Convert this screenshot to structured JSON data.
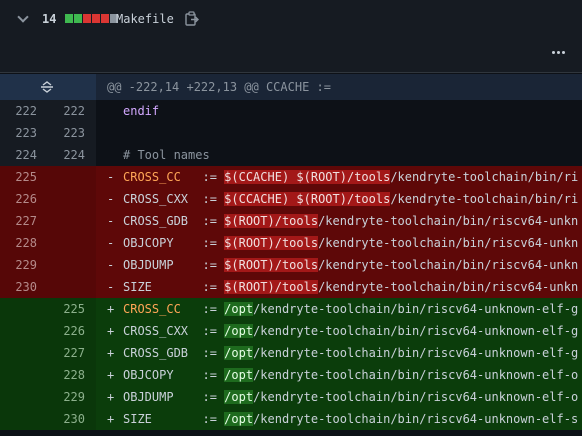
{
  "file": {
    "change_count": "14",
    "name": "Makefile",
    "diffstat": [
      "#3fb950",
      "#3fb950",
      "#da3633",
      "#da3633",
      "#da3633",
      "#8b949e"
    ]
  },
  "hunk": {
    "header": "@@ -222,14 +222,13 @@ CCACHE :="
  },
  "context_lines": [
    {
      "old": "222",
      "new": "222",
      "text": "endif"
    },
    {
      "old": "223",
      "new": "223",
      "text": ""
    },
    {
      "old": "224",
      "new": "224",
      "text": "# Tool names"
    }
  ],
  "deleted_lines": [
    {
      "old": "225",
      "name": "CROSS_CC ",
      "assign": "  := ",
      "hl": "$(CCACHE) $(ROOT)/tools",
      "rest": "/kendryte-toolchain/bin/ri"
    },
    {
      "old": "226",
      "name": "CROSS_CXX",
      "assign": "  := ",
      "hl": "$(CCACHE) $(ROOT)/tools",
      "rest": "/kendryte-toolchain/bin/ri"
    },
    {
      "old": "227",
      "name": "CROSS_GDB",
      "assign": "  := ",
      "hl": "$(ROOT)/tools",
      "rest": "/kendryte-toolchain/bin/riscv64-unkn"
    },
    {
      "old": "228",
      "name": "OBJCOPY  ",
      "assign": "  := ",
      "hl": "$(ROOT)/tools",
      "rest": "/kendryte-toolchain/bin/riscv64-unkn"
    },
    {
      "old": "229",
      "name": "OBJDUMP  ",
      "assign": "  := ",
      "hl": "$(ROOT)/tools",
      "rest": "/kendryte-toolchain/bin/riscv64-unkn"
    },
    {
      "old": "230",
      "name": "SIZE     ",
      "assign": "  := ",
      "hl": "$(ROOT)/tools",
      "rest": "/kendryte-toolchain/bin/riscv64-unkn"
    }
  ],
  "added_lines": [
    {
      "new": "225",
      "name": "CROSS_CC ",
      "assign": "  := ",
      "hl": "/opt",
      "rest": "/kendryte-toolchain/bin/riscv64-unknown-elf-g"
    },
    {
      "new": "226",
      "name": "CROSS_CXX",
      "assign": "  := ",
      "hl": "/opt",
      "rest": "/kendryte-toolchain/bin/riscv64-unknown-elf-g"
    },
    {
      "new": "227",
      "name": "CROSS_GDB",
      "assign": "  := ",
      "hl": "/opt",
      "rest": "/kendryte-toolchain/bin/riscv64-unknown-elf-g"
    },
    {
      "new": "228",
      "name": "OBJCOPY  ",
      "assign": "  := ",
      "hl": "/opt",
      "rest": "/kendryte-toolchain/bin/riscv64-unknown-elf-o"
    },
    {
      "new": "229",
      "name": "OBJDUMP  ",
      "assign": "  := ",
      "hl": "/opt",
      "rest": "/kendryte-toolchain/bin/riscv64-unknown-elf-o"
    },
    {
      "new": "230",
      "name": "SIZE     ",
      "assign": "  := ",
      "hl": "/opt",
      "rest": "/kendryte-toolchain/bin/riscv64-unknown-elf-s"
    }
  ],
  "markers": {
    "del": "-",
    "add": "+"
  },
  "icons": {
    "collapse": "chevron-down-icon",
    "copy": "copy-icon",
    "more": "kebab-horizontal-icon",
    "expand": "unfold-icon"
  }
}
